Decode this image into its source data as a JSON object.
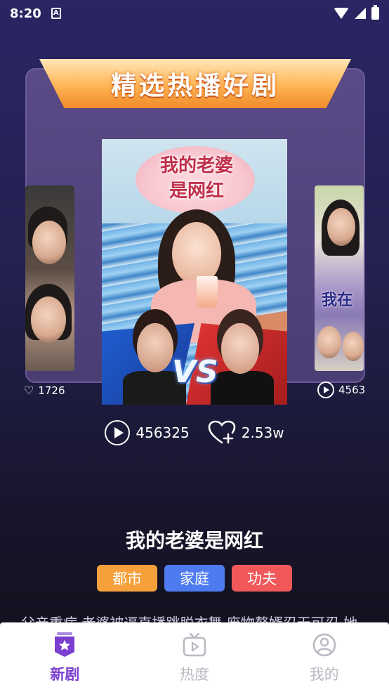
{
  "status_bar": {
    "time": "8:20",
    "notif_glyph": "A"
  },
  "banner": {
    "title": "精选热播好剧"
  },
  "poster": {
    "title_line1": "我的老婆",
    "title_line2": "是网红",
    "vs": "VS"
  },
  "side_cards": {
    "left": {
      "plays": "1726"
    },
    "right": {
      "plays": "4563",
      "overlay_text": "我在"
    }
  },
  "stats": {
    "plays": "456325",
    "likes": "2.53w"
  },
  "drama": {
    "title": "我的老婆是网红",
    "tags": [
      {
        "label": "都市",
        "color": "#f5a03a"
      },
      {
        "label": "家庭",
        "color": "#4f7bf0"
      },
      {
        "label": "功夫",
        "color": "#f0585a"
      }
    ],
    "description": "父亲重病,老婆被逼直播跳脱衣舞,废物赘婿忍无可忍,她"
  },
  "bottom_nav": {
    "items": [
      {
        "label": "新剧",
        "icon": "star-badge-icon",
        "active": true
      },
      {
        "label": "热度",
        "icon": "tv-play-icon",
        "active": false
      },
      {
        "label": "我的",
        "icon": "user-circle-icon",
        "active": false
      }
    ],
    "active_color": "#7b3fcf",
    "inactive_color": "#b9b9c2"
  }
}
